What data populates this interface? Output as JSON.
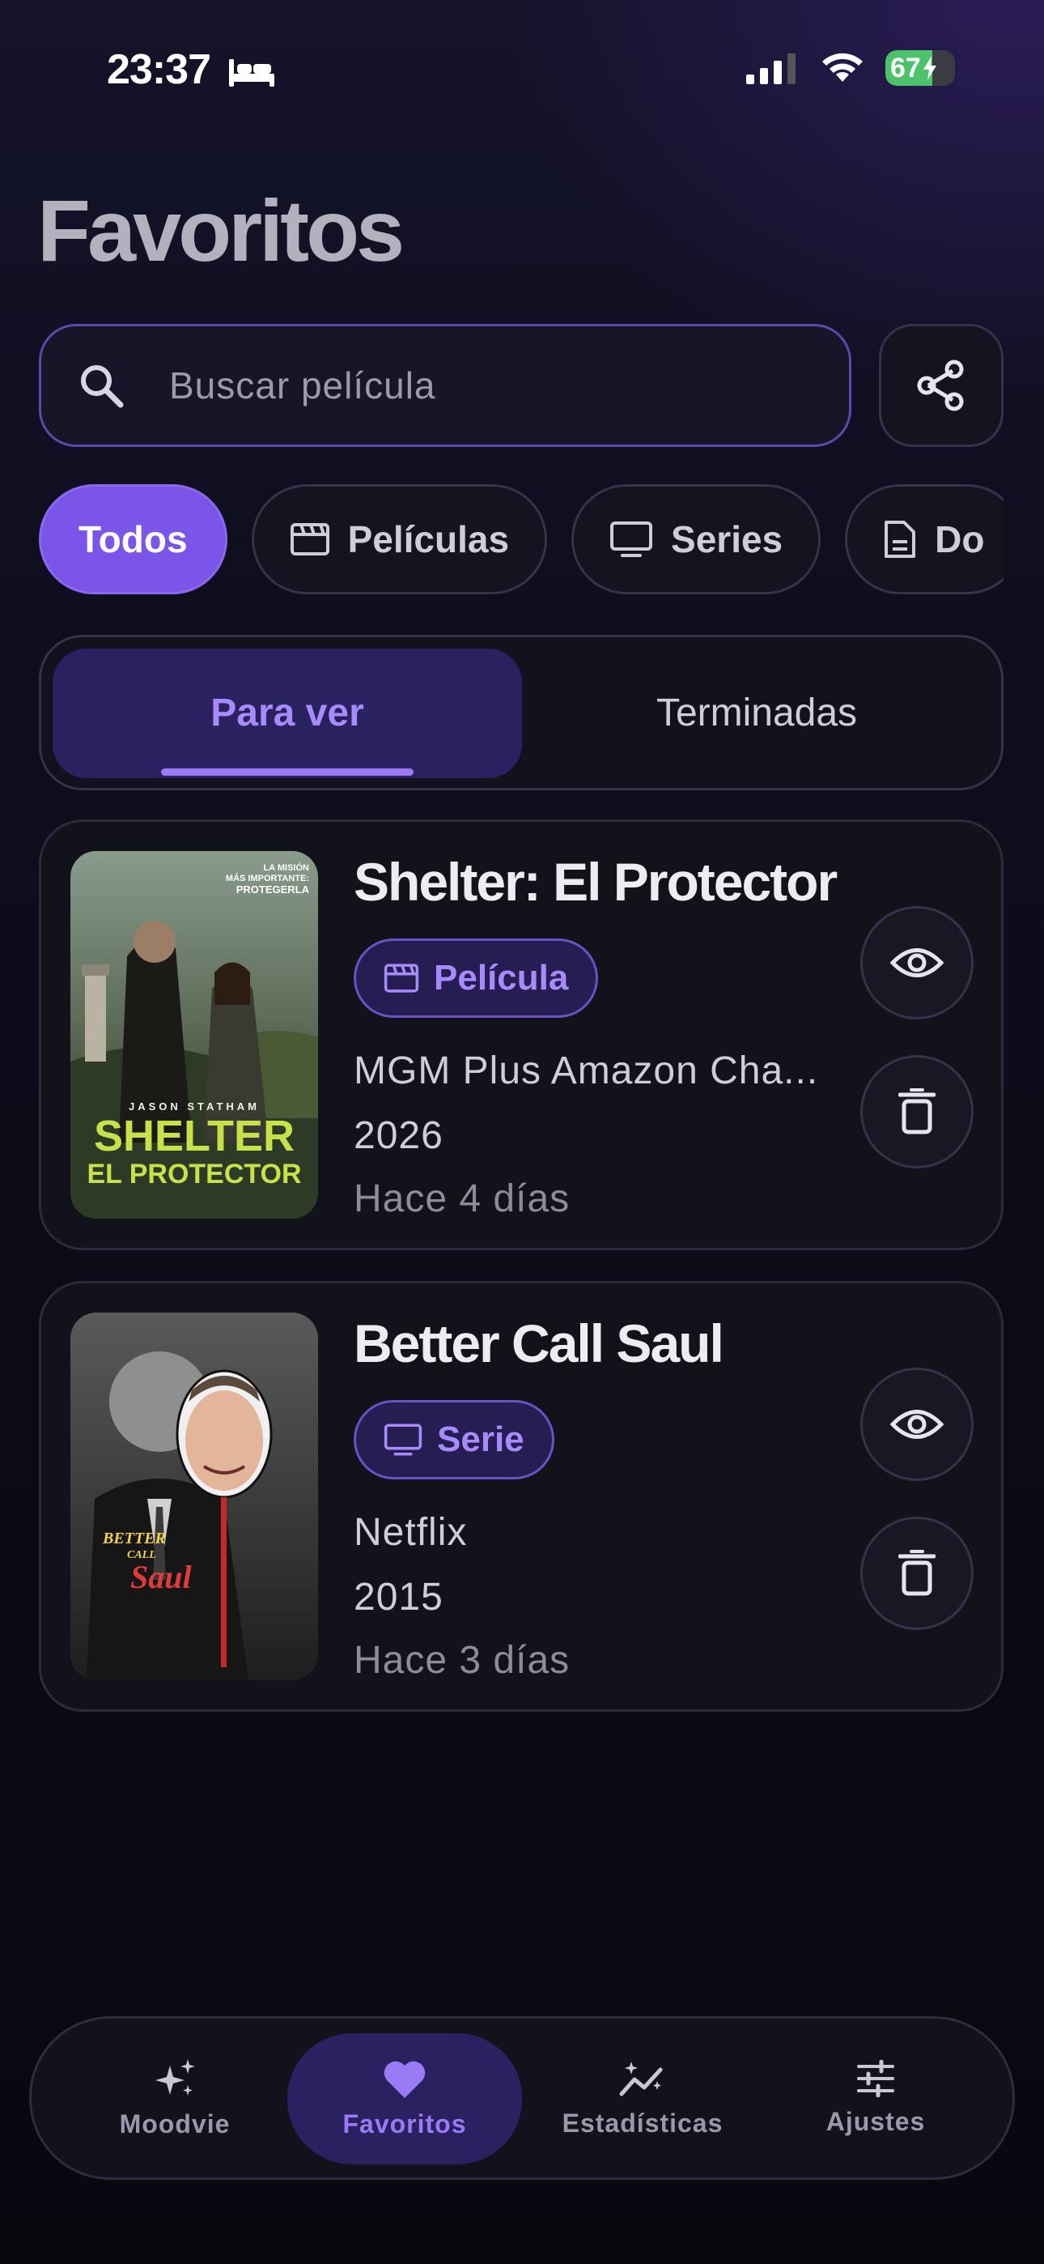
{
  "status_bar": {
    "time": "23:37",
    "battery_level": "67",
    "battery_fraction": 0.67
  },
  "page": {
    "title": "Favoritos"
  },
  "search": {
    "placeholder": "Buscar película"
  },
  "filters": [
    {
      "label": "Todos",
      "icon": "",
      "active": true
    },
    {
      "label": "Películas",
      "icon": "clapperboard-icon",
      "active": false
    },
    {
      "label": "Series",
      "icon": "tv-icon",
      "active": false
    },
    {
      "label": "Do",
      "icon": "document-icon",
      "active": false
    }
  ],
  "segments": {
    "to_watch": "Para ver",
    "finished": "Terminadas",
    "active": "to_watch"
  },
  "items": [
    {
      "title": "Shelter: El Protector",
      "type": "Película",
      "type_icon": "clapperboard-icon",
      "providers": "MGM Plus Amazon Cha...",
      "year": "2026",
      "added": "Hace 4 días",
      "poster": {
        "tagline": "LA MISIÓN MÁS IMPORTANTE: PROTEGERLA",
        "actor": "JASON STATHAM",
        "title_line1": "SHELTER",
        "title_line2": "EL PROTECTOR"
      }
    },
    {
      "title": "Better Call Saul",
      "type": "Serie",
      "type_icon": "tv-icon",
      "providers": "Netflix",
      "year": "2015",
      "added": "Hace 3 días",
      "poster": {
        "logo": "BETTER CALL Saul"
      }
    }
  ],
  "nav": [
    {
      "label": "Moodvie",
      "icon": "sparkles-icon",
      "active": false
    },
    {
      "label": "Favoritos",
      "icon": "heart-icon",
      "active": true
    },
    {
      "label": "Estadísticas",
      "icon": "chart-sparkle-icon",
      "active": false
    },
    {
      "label": "Ajustes",
      "icon": "sliders-icon",
      "active": false
    }
  ],
  "colors": {
    "accent": "#7b54e8",
    "accent_text": "#a78bfa",
    "background": "#0d0d1c",
    "battery_green": "#4cc36a"
  }
}
